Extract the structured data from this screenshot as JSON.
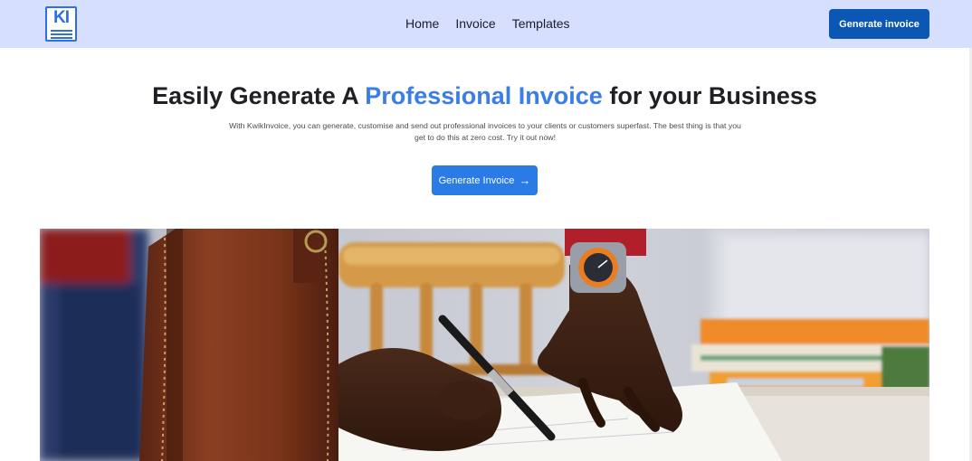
{
  "navbar": {
    "logo_text": "KI",
    "links": [
      "Home",
      "Invoice",
      "Templates"
    ],
    "cta_label": "Generate invoice"
  },
  "hero": {
    "title_before": "Easily Generate A ",
    "title_accent": "Professional Invoice",
    "title_after": " for your Business",
    "description": "With KwikInvoice, you can generate, customise and send out professional invoices to your clients or customers superfast. The best thing is that you get to do this at zero cost. Try it out now!",
    "cta_label": "Generate Invoice",
    "cta_icon": "arrow-right-icon"
  },
  "image": {
    "subject": "hands-writing-on-paper-photo"
  },
  "colors": {
    "nav_bg": "#d6dffd",
    "nav_cta_bg": "#0b57b3",
    "accent": "#3b7de9",
    "hero_cta_bg": "#2b7be6"
  }
}
